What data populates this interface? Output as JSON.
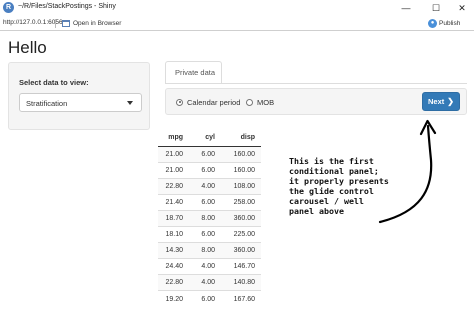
{
  "window": {
    "title": "~/R/Files/StackPostings - Shiny",
    "icon_letter": "R",
    "minimize_glyph": "—",
    "maximize_glyph": "☐",
    "close_glyph": "✕"
  },
  "browser": {
    "url": "http://127.0.0.1:6056",
    "open_in_browser": "Open in Browser",
    "publish": "Publish"
  },
  "app": {
    "title": "Hello",
    "sidebar": {
      "label": "Select data to view:",
      "selected": "Stratification"
    },
    "tabs": [
      {
        "label": "Private data",
        "active": true
      }
    ],
    "well": {
      "radios": [
        {
          "label": "Calendar period",
          "checked": true
        },
        {
          "label": "MOB",
          "checked": false
        }
      ],
      "next_label": "Next",
      "next_icon": "chevron-right-icon"
    },
    "table": {
      "columns": [
        "mpg",
        "cyl",
        "disp"
      ],
      "rows": [
        [
          "21.00",
          "6.00",
          "160.00"
        ],
        [
          "21.00",
          "6.00",
          "160.00"
        ],
        [
          "22.80",
          "4.00",
          "108.00"
        ],
        [
          "21.40",
          "6.00",
          "258.00"
        ],
        [
          "18.70",
          "8.00",
          "360.00"
        ],
        [
          "18.10",
          "6.00",
          "225.00"
        ],
        [
          "14.30",
          "8.00",
          "360.00"
        ],
        [
          "24.40",
          "4.00",
          "146.70"
        ],
        [
          "22.80",
          "4.00",
          "140.80"
        ],
        [
          "19.20",
          "6.00",
          "167.60"
        ]
      ]
    }
  },
  "annotation": {
    "lines": [
      "This is the first",
      "conditional panel;",
      "it properly presents",
      "the glide control",
      "carousel / well",
      "panel above"
    ]
  },
  "colors": {
    "primary_button": "#337ab7",
    "well_background": "#f5f5f5"
  }
}
